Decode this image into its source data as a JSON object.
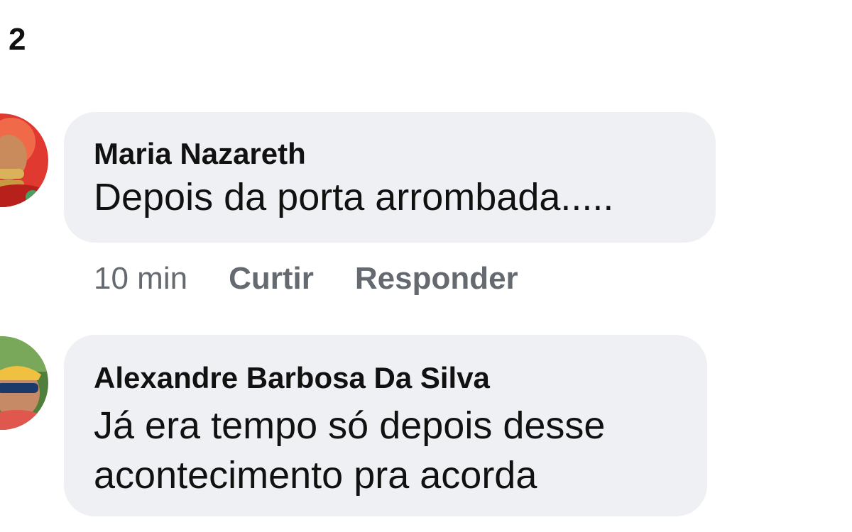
{
  "header": {
    "count": "2"
  },
  "comments": [
    {
      "author": "Maria Nazareth",
      "text": "Depois da porta arrombada.....",
      "time": "10 min",
      "like_label": "Curtir",
      "reply_label": "Responder"
    },
    {
      "author": "Alexandre Barbosa Da Silva",
      "text_line1": "Já era tempo só depois desse",
      "text_line2": "acontecimento pra acorda"
    }
  ],
  "colors": {
    "bubble": "#eff0f3",
    "text": "#111111",
    "muted": "#656970"
  },
  "icons": [
    "avatar-photo",
    "avatar-photo"
  ]
}
